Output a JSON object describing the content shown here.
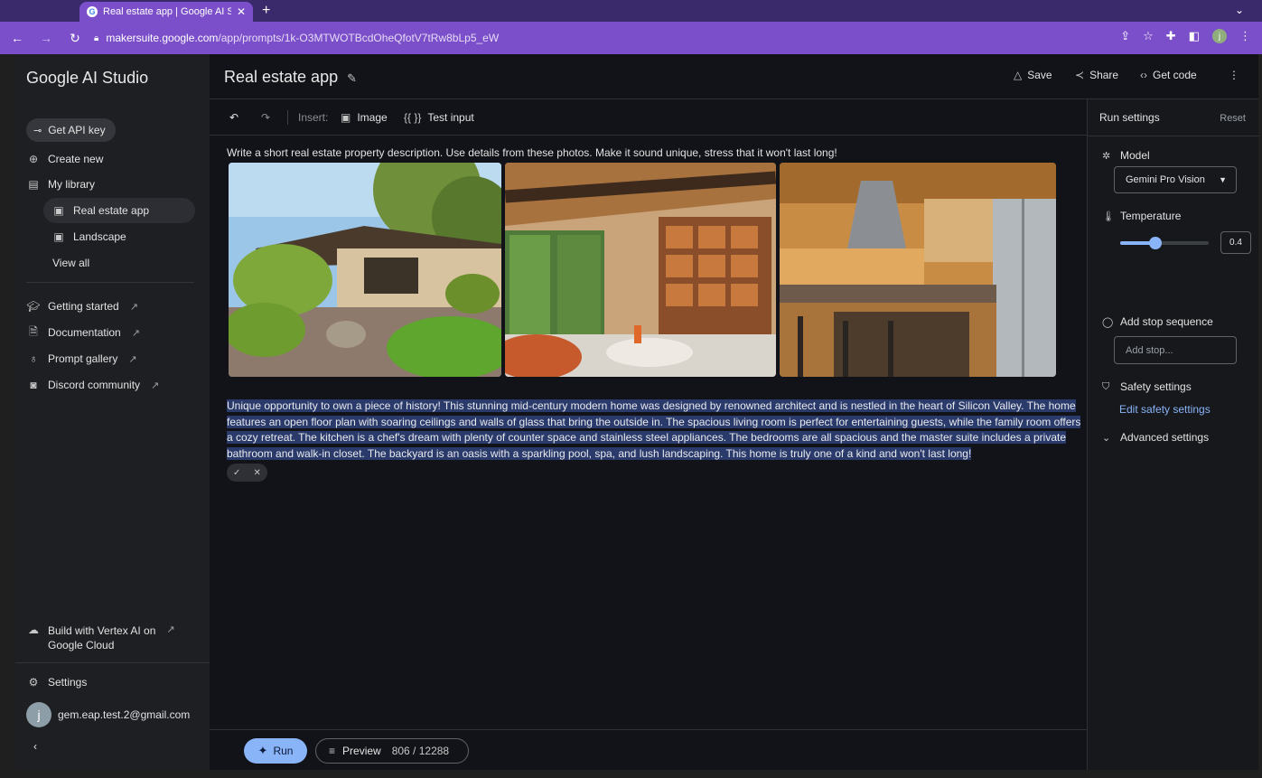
{
  "browser": {
    "tab_title": "Real estate app | Google AI St",
    "url_host": "makersuite.google.com",
    "url_path": "/app/prompts/1k-O3MTWOTBcdOheQfotV7tRw8bLp5_eW",
    "profile_initial": "j"
  },
  "sidebar": {
    "brand": "Google AI Studio",
    "get_api_key": "Get API key",
    "create_new": "Create new",
    "my_library": "My library",
    "library_items": [
      "Real estate app",
      "Landscape"
    ],
    "view_all": "View all",
    "links": [
      "Getting started",
      "Documentation",
      "Prompt gallery",
      "Discord community"
    ],
    "vertex_line1": "Build with Vertex AI on",
    "vertex_line2": "Google Cloud",
    "settings": "Settings",
    "user_initial": "j",
    "user_email": "gem.eap.test.2@gmail.com"
  },
  "header": {
    "title": "Real estate app",
    "save": "Save",
    "share": "Share",
    "get_code": "Get code"
  },
  "toolbar": {
    "insert": "Insert:",
    "image": "Image",
    "test_input_icon": "{{ }}",
    "test_input": "Test input"
  },
  "prompt": {
    "text": "Write a short real estate property description. Use details from these photos. Make it sound unique, stress that it won't last long!",
    "response": "Unique opportunity to own a piece of history! This stunning mid-century modern home was designed by renowned architect and is nestled in the heart of Silicon Valley. The home features an open floor plan with soaring ceilings and walls of glass that bring the outside in. The spacious living room is perfect for entertaining guests, while the family room offers a cozy retreat. The kitchen is a chef's dream with plenty of counter space and stainless steel appliances. The bedrooms are all spacious and the master suite includes a private bathroom and walk-in closet. The backyard is an oasis with a sparkling pool, spa, and lush landscaping. This home is truly one of a kind and won't last long!"
  },
  "runbar": {
    "run": "Run",
    "preview": "Preview",
    "token_count": "806 / 12288"
  },
  "run_settings": {
    "title": "Run settings",
    "reset": "Reset",
    "model_label": "Model",
    "model_value": "Gemini Pro Vision",
    "temperature_label": "Temperature",
    "temperature_value": "0.4",
    "temperature_fraction": 0.4,
    "stop_label": "Add stop sequence",
    "stop_placeholder": "Add stop...",
    "safety_label": "Safety settings",
    "safety_link": "Edit safety settings",
    "advanced_label": "Advanced settings"
  },
  "colors": {
    "accent": "#8ab4f8",
    "chrome": "#7b4fc9",
    "selection": "#2a3a6b"
  }
}
